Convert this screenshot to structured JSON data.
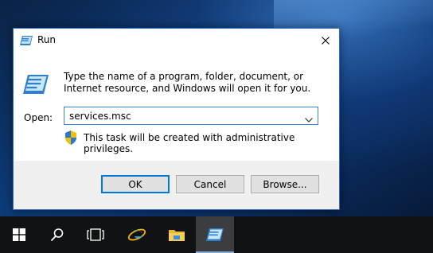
{
  "dialog": {
    "title": "Run",
    "description": "Type the name of a program, folder, document, or Internet resource, and Windows will open it for you.",
    "open_label": "Open:",
    "open_value": "services.msc",
    "admin_notice": "This task will be created with administrative privileges.",
    "buttons": {
      "ok": "OK",
      "cancel": "Cancel",
      "browse": "Browse..."
    }
  },
  "taskbar": {
    "items": [
      {
        "icon": "windows-start-icon"
      },
      {
        "icon": "search-icon"
      },
      {
        "icon": "task-view-icon"
      },
      {
        "icon": "internet-explorer-icon"
      },
      {
        "icon": "file-explorer-icon"
      },
      {
        "icon": "run-app-icon",
        "active": true
      }
    ]
  },
  "colors": {
    "accent": "#0078d7",
    "taskbar": "#111214",
    "dialog_footer": "#f0f0f0"
  }
}
